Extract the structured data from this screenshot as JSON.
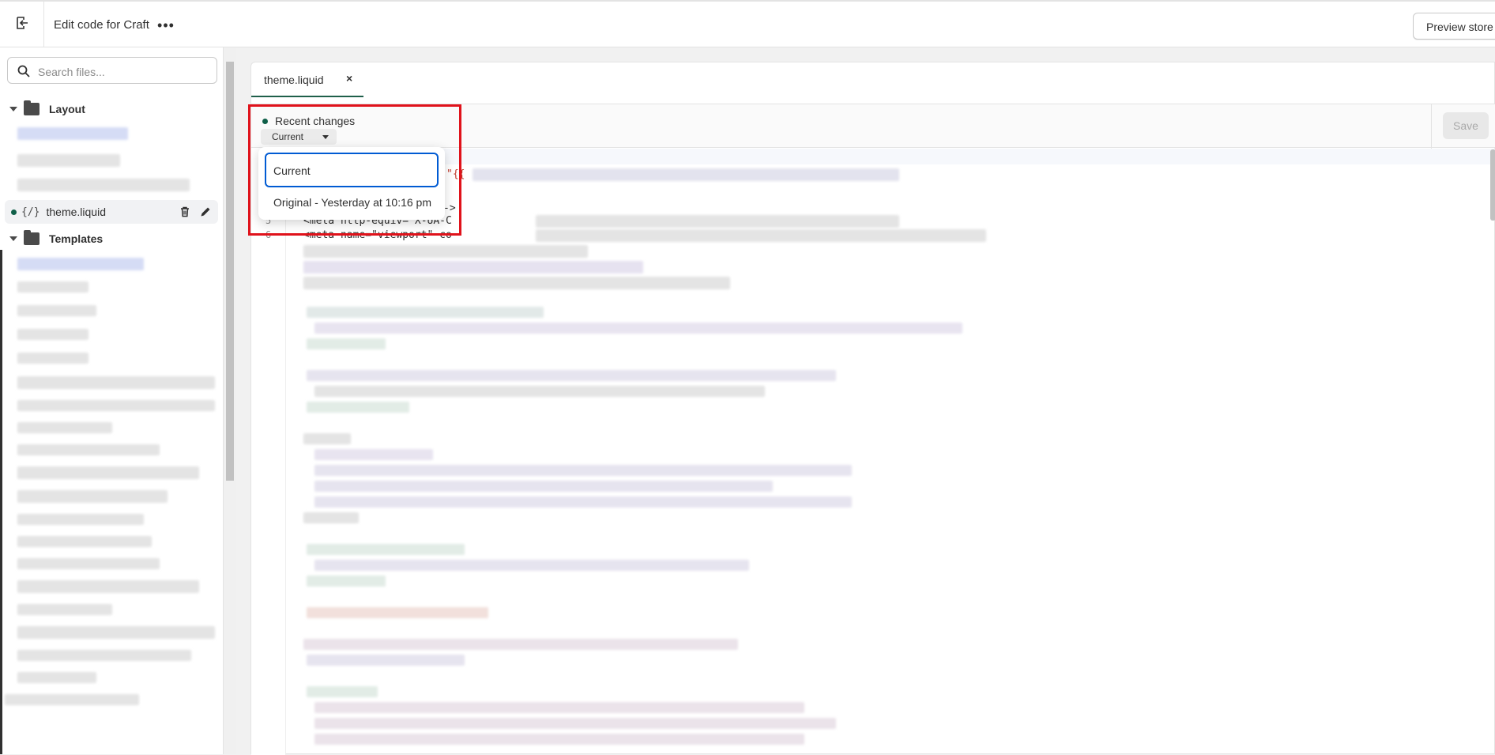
{
  "topbar": {
    "title": "Edit code for Craft",
    "more_label": "•••",
    "preview_label": "Preview store"
  },
  "sidebar": {
    "search_placeholder": "Search files...",
    "folders": [
      {
        "label": "Layout"
      },
      {
        "label": "Templates"
      }
    ],
    "active_file": {
      "icon": "{/}",
      "label": "theme.liquid"
    }
  },
  "editor": {
    "tab_label": "theme.liquid",
    "tab_close": "×",
    "recent_changes_label": "Recent changes",
    "version_selected": "Current",
    "save_label": "Save",
    "line_numbers": [
      "5",
      "6"
    ],
    "visible_code": {
      "line1_fragment": "\"{{",
      "line5": "<meta http-equiv=\"X-UA-C",
      "line6": "<meta name=\"viewport\" co"
    }
  },
  "version_dropdown": {
    "options": [
      {
        "label": "Current"
      },
      {
        "label": "Original - Yesterday at 10:16 pm"
      }
    ],
    "pointer_text": "->"
  },
  "colors": {
    "accent_green": "#0f5f48",
    "focus_blue": "#005bd3",
    "highlight_red": "#e0121b"
  }
}
